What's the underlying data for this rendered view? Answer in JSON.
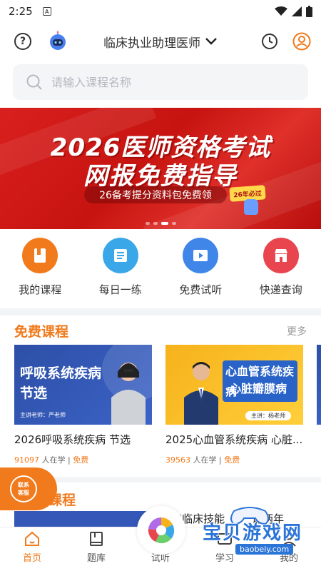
{
  "status_bar": {
    "time": "2:25",
    "notification_letter": "A"
  },
  "header": {
    "exam_title": "临床执业助理医师"
  },
  "search": {
    "placeholder": "请输入课程名称"
  },
  "banner": {
    "line1": "2026医师资格考试",
    "line2": "网报免费指导",
    "pill": "26备考提分资料包免费领",
    "tag": "26年必过",
    "slide_count": 4,
    "active_slide": 3
  },
  "quick_actions": [
    {
      "label": "我的课程",
      "icon": "book-icon",
      "color": "#f07a1c"
    },
    {
      "label": "每日一练",
      "icon": "list-icon",
      "color": "#3aa8e8"
    },
    {
      "label": "免费试听",
      "icon": "play-icon",
      "color": "#3f86e8"
    },
    {
      "label": "快递查询",
      "icon": "store-icon",
      "color": "#e8454f"
    }
  ],
  "free_courses": {
    "title": "免费课程",
    "more": "更多",
    "items": [
      {
        "thumb_title_1": "呼吸系统疾病",
        "thumb_title_2": "节选",
        "thumb_teacher": "主讲老师：严老师",
        "name": "2026呼吸系统疾病 节选",
        "learners": "91097",
        "learners_suffix": "人在学 | ",
        "price": "免费"
      },
      {
        "thumb_title_1": "心血管系统疾病",
        "thumb_title_2": "心脏瓣膜病",
        "thumb_teacher": "主讲：杨老师",
        "name": "2025心血管系统疾病 心脏...",
        "learners": "39563",
        "learners_suffix": "人在学 | ",
        "price": "免费"
      }
    ]
  },
  "second_section": {
    "title_partial": "课程",
    "course_partial": "26临床技能",
    "course_partial_2": "课两年"
  },
  "contact_float": {
    "line1": "联系",
    "line2": "客服"
  },
  "tabs": [
    {
      "label": "首页",
      "icon": "home-icon"
    },
    {
      "label": "题库",
      "icon": "book-icon"
    },
    {
      "label": "试听",
      "icon": "aperture-icon"
    },
    {
      "label": "学习",
      "icon": "study-icon"
    },
    {
      "label": "我的",
      "icon": "user-icon"
    }
  ],
  "watermark": {
    "text": "宝贝游戏网",
    "url": "baobeiy.com"
  }
}
